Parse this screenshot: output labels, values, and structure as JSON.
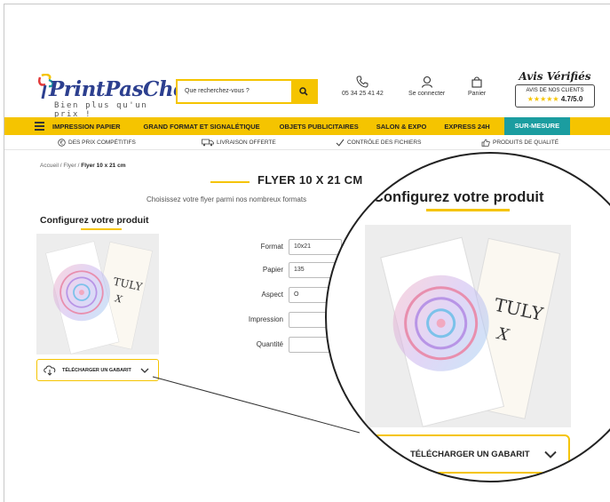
{
  "header": {
    "logo_main": "PrintPasCher",
    "logo_tagline": "Bien plus qu'un prix !",
    "search_placeholder": "Que recherchez-vous ?",
    "phone": "05 34 25 41 42",
    "login": "Se connecter",
    "cart": "Panier",
    "reviews": {
      "title": "Avis Vérifiés",
      "subtitle": "AVIS DE NOS CLIENTS",
      "stars": "★★★★★",
      "score": "4.7/5.0"
    }
  },
  "nav": {
    "items": [
      "IMPRESSION PAPIER",
      "GRAND FORMAT ET SIGNALÉTIQUE",
      "OBJETS PUBLICITAIRES",
      "SALON & EXPO",
      "EXPRESS 24H"
    ],
    "highlight": "SUR-MESURE"
  },
  "benefits": [
    "DES PRIX COMPÉTITIFS",
    "LIVRAISON OFFERTE",
    "CONTRÔLE DES FICHIERS",
    "PRODUITS DE QUALITÉ"
  ],
  "breadcrumb": {
    "home": "Accueil",
    "sep": " / ",
    "parent": "Flyer",
    "current": "Flyer 10 x 21 cm"
  },
  "page": {
    "title": "FLYER 10 X 21 CM",
    "subtitle": "Choisissez votre flyer parmi nos nombreux formats",
    "configure": "Configurez votre produit",
    "download": "TÉLÉCHARGER UN GABARIT"
  },
  "form": {
    "fields": [
      {
        "label": "Format",
        "value": "10x21"
      },
      {
        "label": "Papier",
        "value": "135"
      },
      {
        "label": "Aspect",
        "value": "O"
      },
      {
        "label": "Impression",
        "value": ""
      },
      {
        "label": "Quantité",
        "value": ""
      }
    ]
  },
  "magnifier": {
    "title": "Configurez votre produit",
    "download": "TÉLÉCHARGER UN GABARIT"
  },
  "colors": {
    "accent": "#f5c400",
    "teal": "#1b9da0",
    "brand_blue": "#2c3f8f"
  }
}
